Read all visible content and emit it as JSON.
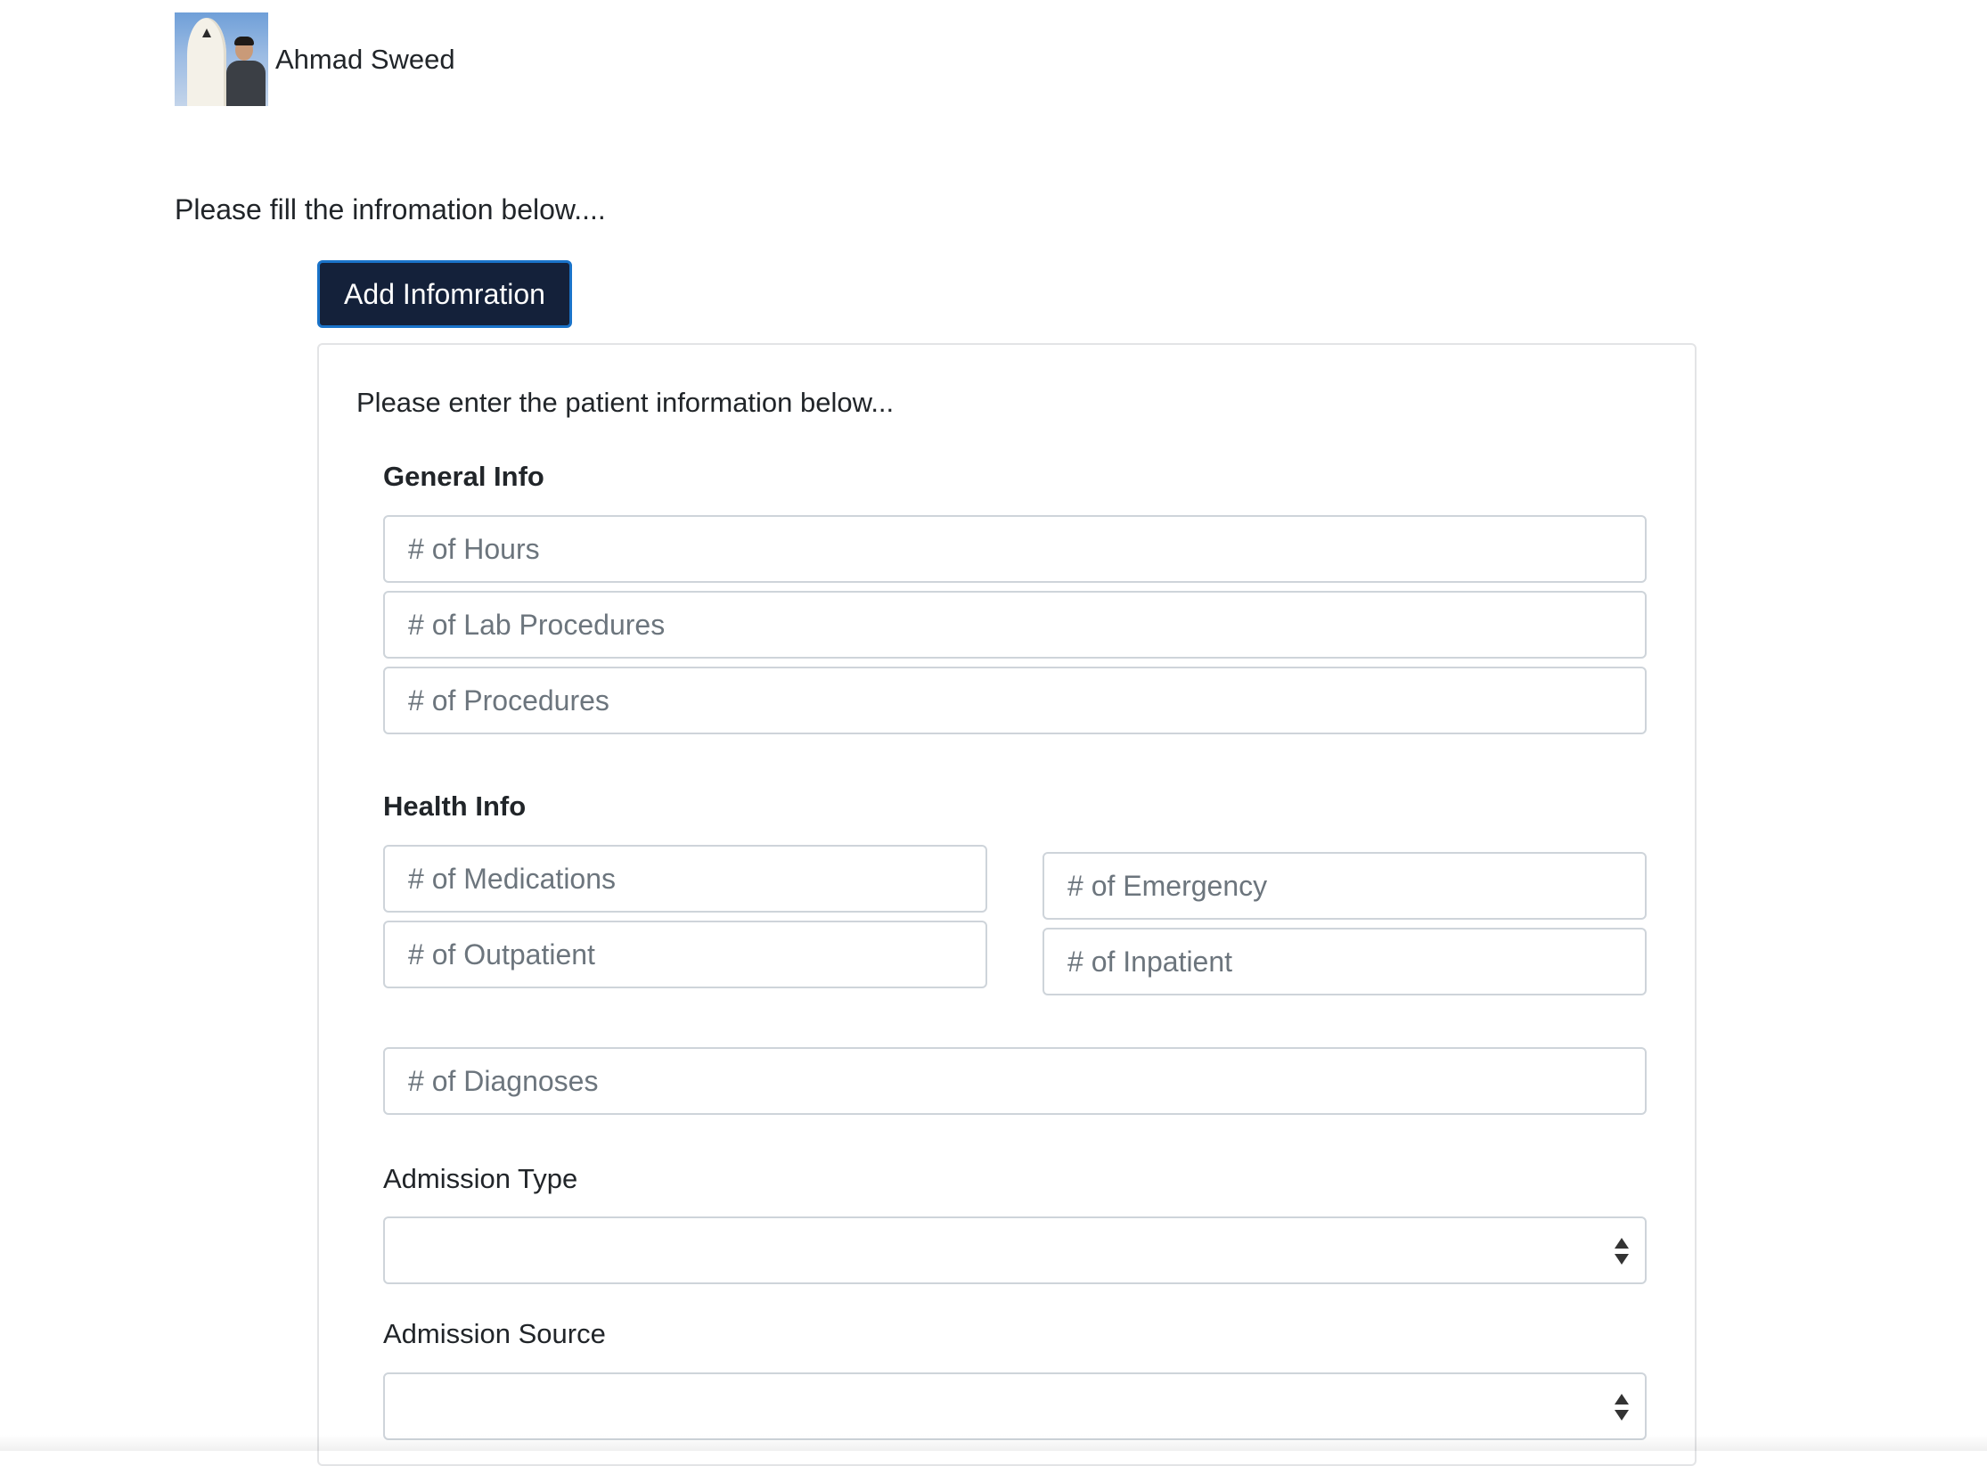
{
  "user": {
    "name": "Ahmad Sweed",
    "avatar_icon": "profile-photo"
  },
  "intro_text": "Please fill the infromation below....",
  "add_button_label": "Add Infomration",
  "card": {
    "intro_text": "Please enter the patient information below...",
    "general_info": {
      "title": "General Info",
      "fields": [
        {
          "placeholder": "# of Hours",
          "value": ""
        },
        {
          "placeholder": "# of Lab Procedures",
          "value": ""
        },
        {
          "placeholder": "# of Procedures",
          "value": ""
        }
      ]
    },
    "health_info": {
      "title": "Health Info",
      "fields": [
        {
          "placeholder": "# of Medications",
          "value": ""
        },
        {
          "placeholder": "# of Outpatient",
          "value": ""
        },
        {
          "placeholder": "# of Emergency",
          "value": ""
        },
        {
          "placeholder": "# of Inpatient",
          "value": ""
        },
        {
          "placeholder": "# of Diagnoses",
          "value": ""
        }
      ]
    },
    "admission_type": {
      "label": "Admission Type",
      "selected": ""
    },
    "admission_source": {
      "label": "Admission Source",
      "selected": ""
    }
  },
  "colors": {
    "button_bg": "#14213a",
    "button_border": "#1a73c9",
    "input_border": "#ced4da",
    "placeholder": "#6c757d"
  }
}
